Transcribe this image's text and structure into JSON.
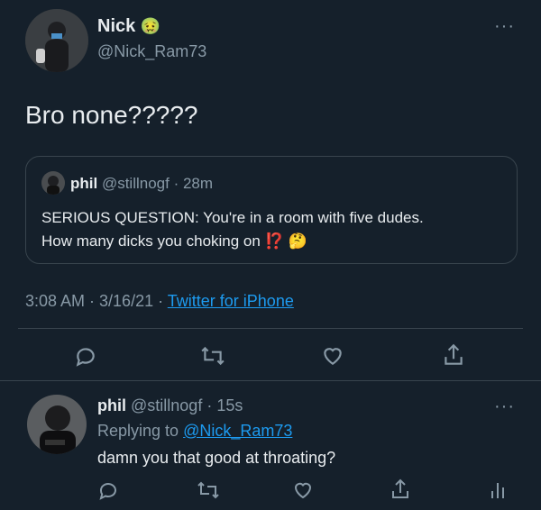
{
  "main_tweet": {
    "author_name": "Nick",
    "author_emoji": "🤢",
    "author_handle": "@Nick_Ram73",
    "text": "Bro none?????",
    "quoted": {
      "author_name": "phil",
      "author_handle": "@stillnogf",
      "time": "· 28m",
      "text_line1": "SERIOUS QUESTION: You're in a room with five dudes.",
      "text_line2": "How many dicks you choking on",
      "emoji": "⁉️ 🤔"
    },
    "meta_time": "3:08 AM · 3/16/21 ·",
    "meta_source": "Twitter for iPhone",
    "more": "···"
  },
  "reply_tweet": {
    "author_name": "phil",
    "author_handle": "@stillnogf",
    "time": "· 15s",
    "replying_prefix": "Replying to",
    "replying_handle": "@Nick_Ram73",
    "text": "damn you that good at throating?",
    "more": "···"
  },
  "colors": {
    "background": "#15202b",
    "text": "#e8ecef",
    "muted": "#8899a6",
    "link": "#1d9bf0"
  }
}
